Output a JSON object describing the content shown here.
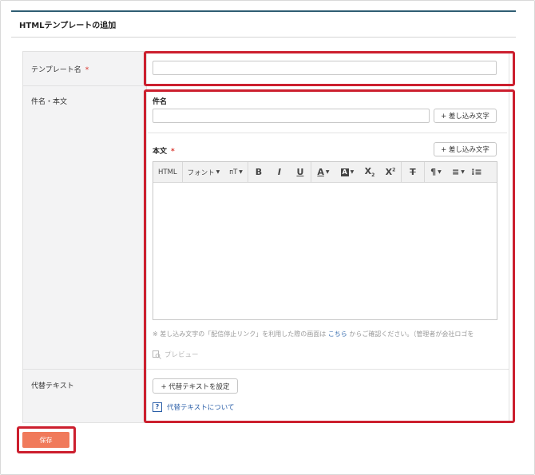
{
  "page": {
    "title": "HTMLテンプレートの追加"
  },
  "form": {
    "template_name": {
      "label": "テンプレート名",
      "required_mark": "*",
      "value": ""
    },
    "subject_body": {
      "label": "件名・本文",
      "subject": {
        "label": "件名",
        "value": "",
        "insert_button": "+ 差し込み文字"
      },
      "body": {
        "label": "本文",
        "required_mark": "*",
        "insert_button": "+ 差し込み文字",
        "toolbar": {
          "html": "HTML",
          "font": "フォント",
          "fontsize": "ᴨT"
        },
        "note": {
          "prefix": "※ 差し込み文字の「配信停止リンク」を利用した際の画面は ",
          "link": "こちら",
          "suffix": " からご確認ください。（管理者が会社ロゴを"
        },
        "preview": "プレビュー"
      }
    },
    "alt_text": {
      "label": "代替テキスト",
      "set_button": "+ 代替テキストを設定",
      "help_link": "代替テキストについて"
    }
  },
  "actions": {
    "save": "保存"
  },
  "colors": {
    "highlight": "#cc1f2e",
    "save": "#f07a5b",
    "link": "#2b5fa8",
    "header_line": "#2f5d73"
  }
}
